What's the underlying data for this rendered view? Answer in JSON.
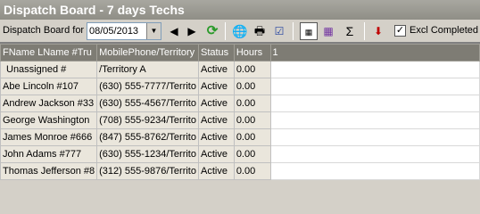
{
  "window": {
    "title": "Dispatch Board - 7 days Techs"
  },
  "toolbar": {
    "label": "Dispatch Board for",
    "date": "08/05/2013",
    "excl_completed_label": "Excl Completed",
    "excl_completed_checked": "✓"
  },
  "grid": {
    "columns": [
      "FName LName #Tru",
      "MobilePhone/Territory",
      "Status",
      "Hours",
      "1"
    ],
    "rows": [
      {
        "name": "Unassigned #",
        "phone": "/Territory A",
        "status": "Active",
        "hours": "0.00"
      },
      {
        "name": "Abe Lincoln #107",
        "phone": "(630) 555-7777/Territo",
        "status": "Active",
        "hours": "0.00"
      },
      {
        "name": "Andrew Jackson #33",
        "phone": "(630) 555-4567/Territo",
        "status": "Active",
        "hours": "0.00"
      },
      {
        "name": "George Washington",
        "phone": "(708) 555-9234/Territo",
        "status": "Active",
        "hours": "0.00"
      },
      {
        "name": "James Monroe #666",
        "phone": "(847) 555-8762/Territo",
        "status": "Active",
        "hours": "0.00"
      },
      {
        "name": "John Adams #777",
        "phone": "(630) 555-1234/Territo",
        "status": "Active",
        "hours": "0.00"
      },
      {
        "name": "Thomas Jefferson #8",
        "phone": "(312) 555-9876/Territo",
        "status": "Active",
        "hours": "0.00"
      }
    ]
  }
}
